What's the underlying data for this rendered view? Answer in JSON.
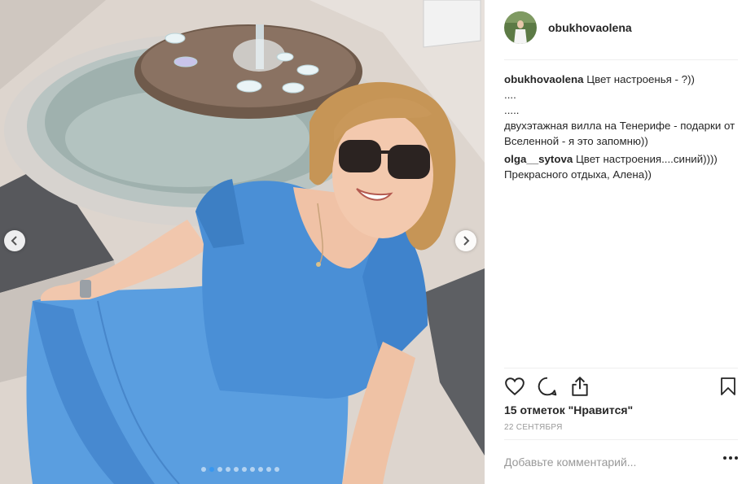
{
  "post": {
    "username": "obukhovaolena",
    "caption": {
      "author": "obukhovaolena",
      "lines": [
        "Цвет настроенья - ?))",
        "....",
        ".....",
        "двухэтажная вилла на Тенерифе - подарки от Вселенной - я это запомню))"
      ]
    },
    "comments": [
      {
        "author": "olga__sytova",
        "text": "Цвет настроения....синий)))) Прекрасного отдыха, Алена))"
      }
    ],
    "likes_text": "15 отметок \"Нравится\"",
    "date": "22 сентября",
    "add_comment_placeholder": "Добавьте комментарий..."
  },
  "carousel": {
    "total": 10,
    "active_index": 1
  },
  "icons": {
    "prev": "chevron-left-icon",
    "next": "chevron-right-icon",
    "like": "heart-icon",
    "comment": "comment-icon",
    "share": "share-icon",
    "save": "bookmark-icon",
    "more": "more-dots-icon"
  },
  "colors": {
    "accent": "#3897f0",
    "text": "#262626",
    "muted": "#999999",
    "divider": "#efefef",
    "dress": "#4a8fd6"
  }
}
